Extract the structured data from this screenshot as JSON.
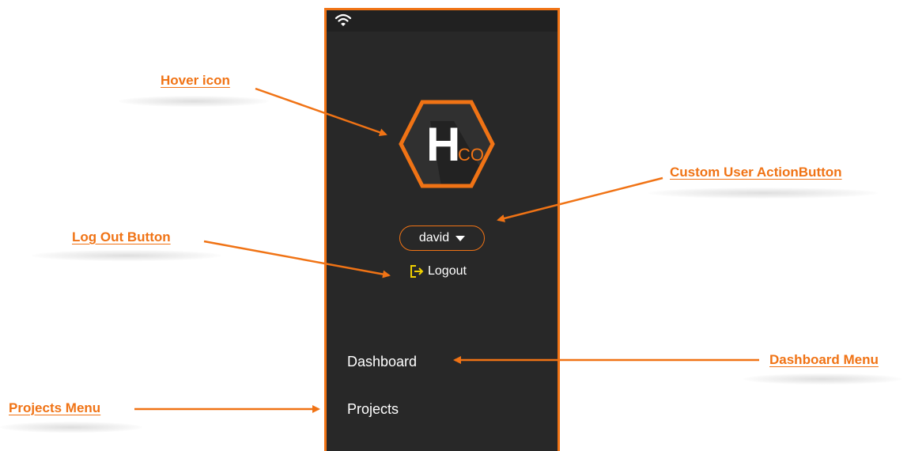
{
  "colors": {
    "accent": "#f07315",
    "panel_bg": "#282828",
    "status_bg": "#212121",
    "logout_icon": "#f0d000"
  },
  "annotations": {
    "hover_icon": "Hover icon",
    "custom_user_action_button": "Custom User ActionButton",
    "log_out_button": "Log Out Button",
    "dashboard_menu": "Dashboard Menu",
    "projects_menu": "Projects Menu"
  },
  "status_bar": {
    "icon": "wifi-icon"
  },
  "logo": {
    "letter": "H",
    "suffix": "CO",
    "icon": "hexagon-logo-icon"
  },
  "user_menu": {
    "username": "david",
    "icon": "caret-down-icon"
  },
  "logout": {
    "label": "Logout",
    "icon": "logout-icon"
  },
  "menu": {
    "dashboard": "Dashboard",
    "projects": "Projects"
  }
}
